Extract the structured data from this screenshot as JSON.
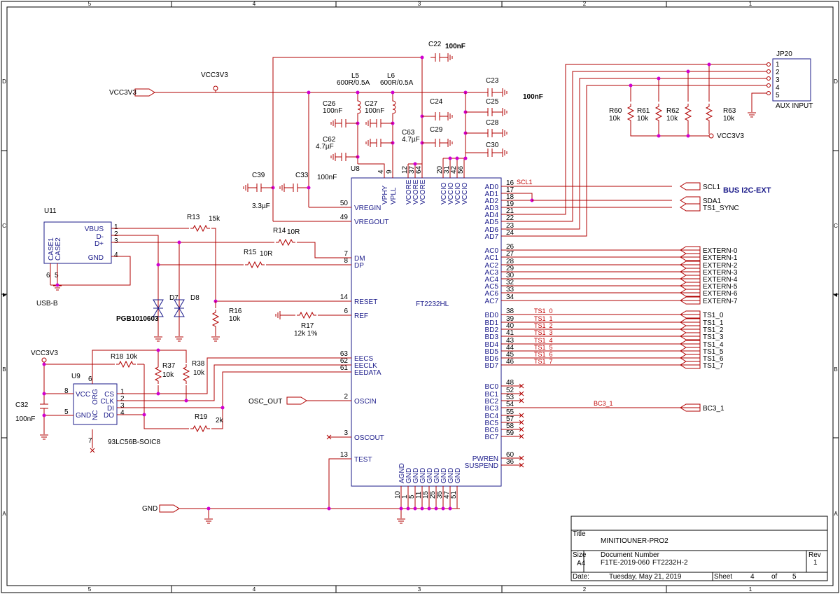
{
  "border": {
    "columns": [
      "5",
      "4",
      "3",
      "2",
      "1"
    ],
    "rows": [
      "D",
      "C",
      "B",
      "A"
    ]
  },
  "title_block": {
    "title_label": "Title",
    "title": "MINITIOUNER-PRO2",
    "size_label": "Size",
    "size": "A4",
    "docnum_label": "Document Number",
    "docnum": "F1TE-2019-060",
    "docname": "FT2232H-2",
    "rev_label": "Rev",
    "rev": "1",
    "date_label": "Date:",
    "date": "Tuesday, May 21, 2019",
    "sheet_label": "Sheet",
    "sheet": "4",
    "of_label": "of",
    "sheets": "5"
  },
  "ic": {
    "ref": "FT2232HL",
    "left_pins": [
      {
        "num": "50",
        "name": "VREGIN"
      },
      {
        "num": "49",
        "name": "VREGOUT"
      },
      {
        "num": "7",
        "name": "DM"
      },
      {
        "num": "8",
        "name": "DP"
      },
      {
        "num": "14",
        "name": "RESET"
      },
      {
        "num": "6",
        "name": "REF"
      },
      {
        "num": "63",
        "name": "EECS"
      },
      {
        "num": "62",
        "name": "EECLK"
      },
      {
        "num": "61",
        "name": "EEDATA"
      },
      {
        "num": "2",
        "name": "OSCIN"
      },
      {
        "num": "3",
        "name": "OSCOUT"
      },
      {
        "num": "13",
        "name": "TEST"
      }
    ],
    "right_pins": [
      {
        "num": "16",
        "name": "AD0"
      },
      {
        "num": "17",
        "name": "AD1"
      },
      {
        "num": "18",
        "name": "AD2"
      },
      {
        "num": "19",
        "name": "AD3"
      },
      {
        "num": "21",
        "name": "AD4"
      },
      {
        "num": "22",
        "name": "AD5"
      },
      {
        "num": "23",
        "name": "AD6"
      },
      {
        "num": "24",
        "name": "AD7"
      },
      {
        "num": "26",
        "name": "AC0"
      },
      {
        "num": "27",
        "name": "AC1"
      },
      {
        "num": "28",
        "name": "AC2"
      },
      {
        "num": "29",
        "name": "AC3"
      },
      {
        "num": "30",
        "name": "AC4"
      },
      {
        "num": "32",
        "name": "AC5"
      },
      {
        "num": "33",
        "name": "AC6"
      },
      {
        "num": "34",
        "name": "AC7"
      },
      {
        "num": "38",
        "name": "BD0"
      },
      {
        "num": "39",
        "name": "BD1"
      },
      {
        "num": "40",
        "name": "BD2"
      },
      {
        "num": "41",
        "name": "BD3"
      },
      {
        "num": "43",
        "name": "BD4"
      },
      {
        "num": "44",
        "name": "BD5"
      },
      {
        "num": "45",
        "name": "BD6"
      },
      {
        "num": "46",
        "name": "BD7"
      },
      {
        "num": "48",
        "name": "BC0"
      },
      {
        "num": "52",
        "name": "BC1"
      },
      {
        "num": "53",
        "name": "BC2"
      },
      {
        "num": "54",
        "name": "BC3"
      },
      {
        "num": "55",
        "name": "BC4"
      },
      {
        "num": "57",
        "name": "BC5"
      },
      {
        "num": "58",
        "name": "BC6"
      },
      {
        "num": "59",
        "name": "BC7"
      },
      {
        "num": "60",
        "name": "PWREN"
      },
      {
        "num": "36",
        "name": "SUSPEND"
      }
    ],
    "top_pins": [
      {
        "num": "4",
        "name": "VPHY"
      },
      {
        "num": "9",
        "name": "VPLL"
      },
      {
        "num": "12",
        "name": "VCORE"
      },
      {
        "num": "37",
        "name": "VCORE"
      },
      {
        "num": "64",
        "name": "VCORE"
      },
      {
        "num": "20",
        "name": "VCCIO"
      },
      {
        "num": "31",
        "name": "VCCIO"
      },
      {
        "num": "42",
        "name": "VCCIO"
      },
      {
        "num": "56",
        "name": "VCCIO"
      }
    ],
    "bottom_pins": [
      {
        "num": "10",
        "name": "AGND"
      },
      {
        "num": "1",
        "name": "GND"
      },
      {
        "num": "5",
        "name": "GND"
      },
      {
        "num": "11",
        "name": "GND"
      },
      {
        "num": "15",
        "name": "GND"
      },
      {
        "num": "25",
        "name": "GND"
      },
      {
        "num": "35",
        "name": "GND"
      },
      {
        "num": "47",
        "name": "GND"
      },
      {
        "num": "51",
        "name": "GND"
      }
    ]
  },
  "outputs": {
    "ad": [
      "SCL1",
      "",
      "SDA1",
      "TS1_SYNC"
    ],
    "extern": [
      "EXTERN-0",
      "EXTERN-1",
      "EXTERN-2",
      "EXTERN-3",
      "EXTERN-4",
      "EXTERN-5",
      "EXTERN-6",
      "EXTERN-7"
    ],
    "ts": [
      "TS1_0",
      "TS1_1",
      "TS1_2",
      "TS1_3",
      "TS1_4",
      "TS1_5",
      "TS1_6",
      "TS1_7"
    ],
    "bc3": "BC3_1"
  },
  "net_labels": {
    "scl1": "SCL1",
    "ts": [
      "TS1_0",
      "TS1_1",
      "TS1_2",
      "TS1_3",
      "TS1_4",
      "TS1_5",
      "TS1_6",
      "TS1_7"
    ],
    "bc3": "BC3_1"
  },
  "bus_label": "BUS I2C-EXT",
  "labels": {
    "vcc_top": "VCC3V3",
    "vcc_in": "VCC3V3",
    "vcc_left": "VCC3V3",
    "vcc_pullup": "VCC3V3",
    "gnd": "GND",
    "osc_out": "OSC_OUT",
    "c22_ref": "C22",
    "c22_val": "100nF",
    "c23_ref": "C23",
    "c23_val": "100nF",
    "c24_ref": "C24",
    "c25_ref": "C25",
    "c28_ref": "C28",
    "c29_ref": "C29",
    "c30_ref": "C30",
    "l5_ref": "L5",
    "l5_val": "600R/0.5A",
    "l6_ref": "L6",
    "l6_val": "600R/0.5A",
    "c26_ref": "C26",
    "c26_val": "100nF",
    "c27_ref": "C27",
    "c27_val": "100nF",
    "c62_ref": "C62",
    "c62_val": "4.7µF",
    "c63_ref": "C63",
    "c63_val": "4.7µF",
    "u8_ref": "U8",
    "c39_ref": "C39",
    "c39_val": "3.3µF",
    "c33_ref": "C33",
    "c33_val": "100nF",
    "u11_ref": "U11",
    "usb_pins": [
      "VBUS",
      "D-",
      "D+",
      "GND"
    ],
    "usb_nums": [
      "1",
      "2",
      "3",
      "4"
    ],
    "usb_case": [
      "CASE1",
      "CASE2"
    ],
    "usb_case_nums": [
      "6",
      "5"
    ],
    "usb_name": "USB-B",
    "r13_ref": "R13",
    "r13_val": "15k",
    "r14_ref": "R14",
    "r14_val": "10R",
    "r15_ref": "R15",
    "r15_val": "10R",
    "r16_ref": "R16",
    "r16_val": "10k",
    "r17_ref": "R17",
    "r17_val": "12k 1%",
    "d7_ref": "D7",
    "d8_ref": "D8",
    "diode_val": "PGB1010603",
    "u9_ref": "U9",
    "eeprom_left": [
      "VCC",
      "GND"
    ],
    "eeprom_left_nums": [
      "8",
      "5"
    ],
    "eeprom_right": [
      "CS",
      "CLK",
      "DI",
      "DO"
    ],
    "eeprom_right_nums": [
      "1",
      "2",
      "3",
      "4"
    ],
    "eeprom_org": "ORG",
    "eeprom_org_num": "6",
    "eeprom_nc": "NC",
    "eeprom_nc_num": "7",
    "eeprom_name": "93LC56B-SOIC8",
    "c32_ref": "C32",
    "c32_val": "100nF",
    "r18_ref": "R18",
    "r18_val": "10k",
    "r37_ref": "R37",
    "r37_val": "10k",
    "r38_ref": "R38",
    "r38_val": "10k",
    "r19_ref": "R19",
    "r19_val": "2k",
    "jp20_ref": "JP20",
    "jp20_pins": [
      "1",
      "2",
      "3",
      "4",
      "5"
    ],
    "jp20_name": "AUX INPUT",
    "r60_ref": "R60",
    "r60_val": "10k",
    "r61_ref": "R61",
    "r61_val": "10k",
    "r62_ref": "R62",
    "r62_val": "10k",
    "r63_ref": "R63",
    "r63_val": "10k"
  }
}
